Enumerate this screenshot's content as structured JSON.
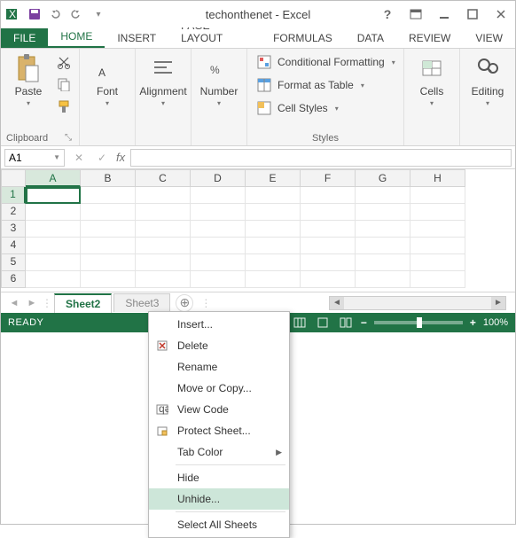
{
  "titlebar": {
    "title": "techonthenet - Excel"
  },
  "tabs": {
    "file": "FILE",
    "home": "HOME",
    "insert": "INSERT",
    "pagelayout": "PAGE LAYOUT",
    "formulas": "FORMULAS",
    "data": "DATA",
    "review": "REVIEW",
    "view": "VIEW"
  },
  "ribbon": {
    "clipboard": {
      "label": "Clipboard",
      "paste": "Paste"
    },
    "font": {
      "label": "Font"
    },
    "alignment": {
      "label": "Alignment"
    },
    "number": {
      "label": "Number"
    },
    "styles": {
      "label": "Styles",
      "cond_formatting": "Conditional Formatting",
      "format_table": "Format as Table",
      "cell_styles": "Cell Styles"
    },
    "cells": {
      "label": "Cells"
    },
    "editing": {
      "label": "Editing"
    }
  },
  "namebox": {
    "value": "A1"
  },
  "grid": {
    "columns": [
      "A",
      "B",
      "C",
      "D",
      "E",
      "F",
      "G",
      "H"
    ],
    "rows": [
      "1",
      "2",
      "3",
      "4",
      "5",
      "6"
    ]
  },
  "sheets": {
    "active": "Sheet2",
    "next": "Sheet3"
  },
  "statusbar": {
    "ready": "READY",
    "zoom": "100%"
  },
  "context_menu": {
    "insert": "Insert...",
    "delete": "Delete",
    "rename": "Rename",
    "move": "Move or Copy...",
    "viewcode": "View Code",
    "protect": "Protect Sheet...",
    "tabcolor": "Tab Color",
    "hide": "Hide",
    "unhide": "Unhide...",
    "selectall": "Select All Sheets"
  }
}
